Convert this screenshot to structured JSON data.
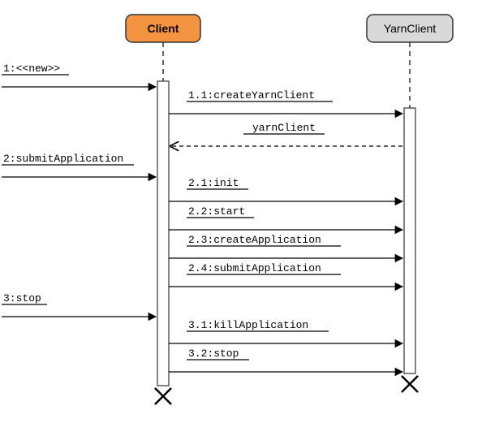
{
  "participants": {
    "client": {
      "label": "Client",
      "fill": "#f59440"
    },
    "yarnClient": {
      "label": "YarnClient",
      "fill": "#d9d9d9"
    }
  },
  "messages": {
    "m1": "1:<<new>>",
    "m11": "1.1:createYarnClient",
    "r11": "yarnClient",
    "m2": "2:submitApplication",
    "m21": "2.1:init",
    "m22": "2.2:start",
    "m23": "2.3:createApplication",
    "m24": "2.4:submitApplication",
    "m3": "3:stop",
    "m31": "3.1:killApplication",
    "m32": "3.2:stop"
  },
  "chart_data": {
    "type": "sequence-diagram",
    "participants": [
      "Client",
      "YarnClient"
    ],
    "interactions": [
      {
        "seq": "1",
        "from": "external",
        "to": "Client",
        "label": "<<new>>",
        "kind": "sync"
      },
      {
        "seq": "1.1",
        "from": "Client",
        "to": "YarnClient",
        "label": "createYarnClient",
        "kind": "sync"
      },
      {
        "seq": "",
        "from": "YarnClient",
        "to": "Client",
        "label": "yarnClient",
        "kind": "return"
      },
      {
        "seq": "2",
        "from": "external",
        "to": "Client",
        "label": "submitApplication",
        "kind": "sync"
      },
      {
        "seq": "2.1",
        "from": "Client",
        "to": "YarnClient",
        "label": "init",
        "kind": "sync"
      },
      {
        "seq": "2.2",
        "from": "Client",
        "to": "YarnClient",
        "label": "start",
        "kind": "sync"
      },
      {
        "seq": "2.3",
        "from": "Client",
        "to": "YarnClient",
        "label": "createApplication",
        "kind": "sync"
      },
      {
        "seq": "2.4",
        "from": "Client",
        "to": "YarnClient",
        "label": "submitApplication",
        "kind": "sync"
      },
      {
        "seq": "3",
        "from": "external",
        "to": "Client",
        "label": "stop",
        "kind": "sync"
      },
      {
        "seq": "3.1",
        "from": "Client",
        "to": "YarnClient",
        "label": "killApplication",
        "kind": "sync"
      },
      {
        "seq": "3.2",
        "from": "Client",
        "to": "YarnClient",
        "label": "stop",
        "kind": "sync"
      }
    ],
    "destroyed": [
      "Client",
      "YarnClient"
    ]
  }
}
